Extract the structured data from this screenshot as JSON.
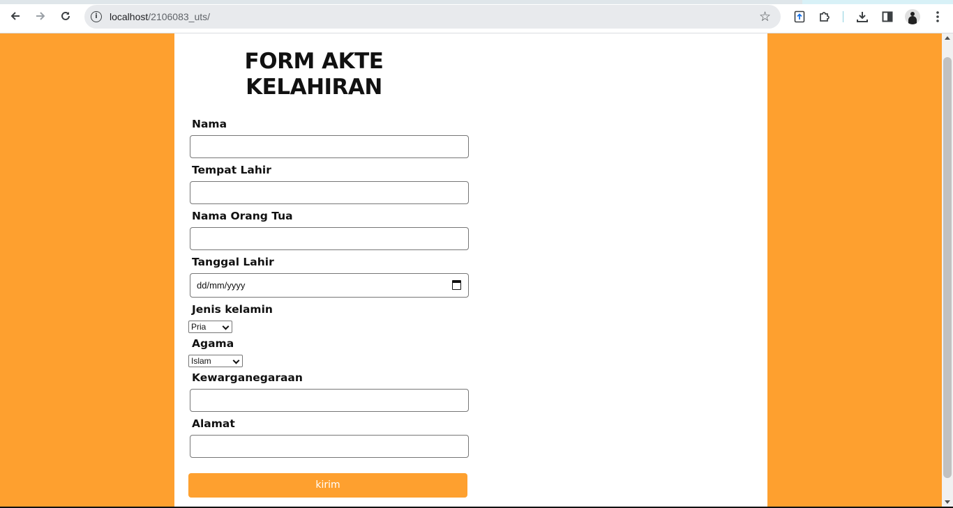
{
  "browser": {
    "url_host": "localhost",
    "url_path": "/2106083_uts/",
    "icons": {
      "back": "arrow-left-icon",
      "forward": "arrow-right-icon",
      "reload": "reload-icon",
      "site_info": "info-icon",
      "bookmark": "star-icon",
      "extension_app": "app-extension-icon",
      "extensions": "puzzle-icon",
      "download": "download-icon",
      "side_panel": "side-panel-icon",
      "profile": "avatar-icon",
      "menu": "kebab-menu-icon"
    }
  },
  "form": {
    "title_line1": "FORM AKTE",
    "title_line2": "KELAHIRAN",
    "fields": {
      "nama": {
        "label": "Nama",
        "value": ""
      },
      "tempat_lahir": {
        "label": "Tempat Lahir",
        "value": ""
      },
      "nama_orang_tua": {
        "label": "Nama Orang Tua",
        "value": ""
      },
      "tanggal_lahir": {
        "label": "Tanggal Lahir",
        "placeholder": "dd/mm/yyyy"
      },
      "jenis_kelamin": {
        "label": "Jenis kelamin",
        "selected": "Pria"
      },
      "agama": {
        "label": "Agama",
        "selected": "Islam"
      },
      "kewarganegaraan": {
        "label": "Kewarganegaraan",
        "value": ""
      },
      "alamat": {
        "label": "Alamat",
        "value": ""
      }
    },
    "submit_label": "kirim"
  },
  "colors": {
    "page_background": "#fea02f",
    "card_background": "#ffffff",
    "button_background": "#fea02f",
    "button_text": "#ffffff"
  }
}
